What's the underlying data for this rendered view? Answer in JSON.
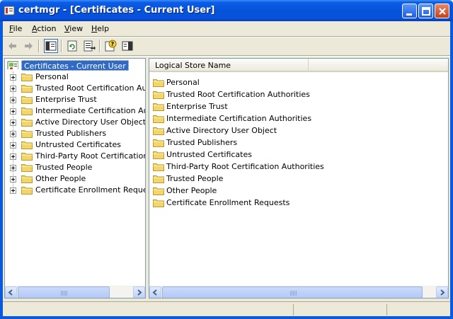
{
  "window": {
    "title": "certmgr - [Certificates - Current User]"
  },
  "menu": [
    {
      "label": "File",
      "access": "F",
      "rest": "ile"
    },
    {
      "label": "Action",
      "access": "A",
      "rest": "ction"
    },
    {
      "label": "View",
      "access": "V",
      "rest": "iew"
    },
    {
      "label": "Help",
      "access": "H",
      "rest": "elp"
    }
  ],
  "toolbar": [
    {
      "icon": "back-arrow-icon"
    },
    {
      "icon": "forward-arrow-icon"
    },
    {
      "icon": "show-hide-console-tree-icon",
      "pressed": true
    },
    {
      "icon": "refresh-icon"
    },
    {
      "icon": "export-list-icon"
    },
    {
      "icon": "help-icon"
    },
    {
      "icon": "show-hide-action-pane-icon"
    }
  ],
  "tree": {
    "root_label": "Certificates - Current User",
    "items": [
      "Personal",
      "Trusted Root Certification Authorities",
      "Enterprise Trust",
      "Intermediate Certification Authorities",
      "Active Directory User Object",
      "Trusted Publishers",
      "Untrusted Certificates",
      "Third-Party Root Certification Authorities",
      "Trusted People",
      "Other People",
      "Certificate Enrollment Requests"
    ]
  },
  "list": {
    "column_header": "Logical Store Name",
    "items": [
      "Personal",
      "Trusted Root Certification Authorities",
      "Enterprise Trust",
      "Intermediate Certification Authorities",
      "Active Directory User Object",
      "Trusted Publishers",
      "Untrusted Certificates",
      "Third-Party Root Certification Authorities",
      "Trusted People",
      "Other People",
      "Certificate Enrollment Requests"
    ]
  },
  "colors": {
    "selection": "#316ac5",
    "folder": "#f3d56b",
    "titlebar": "#0653d8"
  }
}
